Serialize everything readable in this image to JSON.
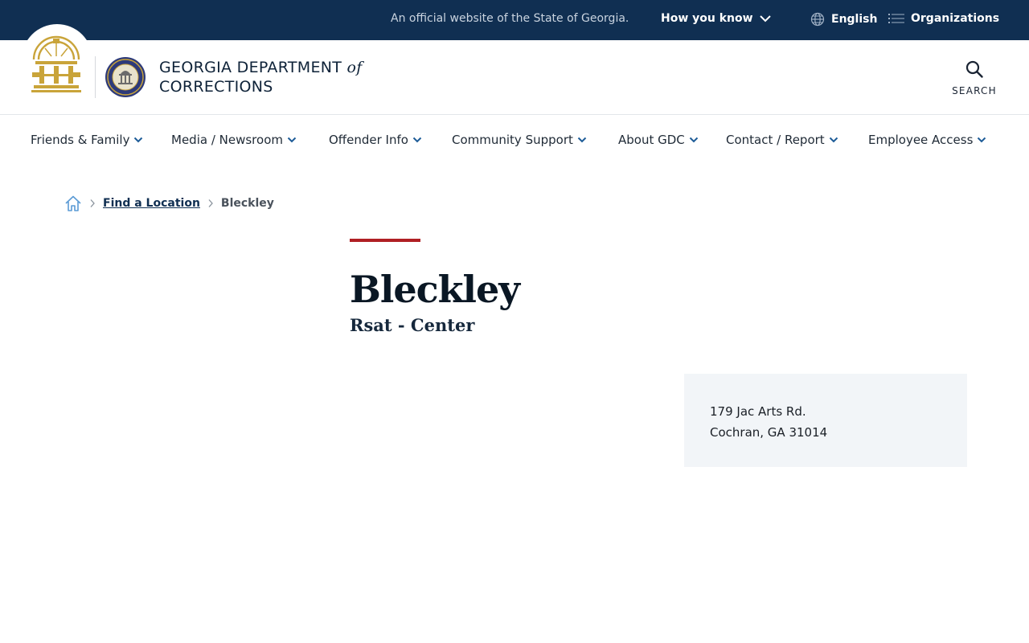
{
  "topbar": {
    "official_text": "An official website of the State of Georgia.",
    "how_you_know": "How you know",
    "language": "English",
    "organizations": "Organizations"
  },
  "header": {
    "agency_line1": "GEORGIA DEPARTMENT",
    "agency_of": "of",
    "agency_line2": "CORRECTIONS",
    "search_label": "SEARCH"
  },
  "nav": {
    "items": [
      {
        "label": "Friends & Family"
      },
      {
        "label": "Media / Newsroom"
      },
      {
        "label": "Offender Info"
      },
      {
        "label": "Community Support"
      },
      {
        "label": "About GDC"
      },
      {
        "label": "Contact / Report"
      },
      {
        "label": "Employee Access"
      }
    ]
  },
  "breadcrumb": {
    "home_icon": "home-icon",
    "link": "Find a Location",
    "current": "Bleckley"
  },
  "main": {
    "title": "Bleckley",
    "subtitle": "Rsat - Center"
  },
  "address": {
    "street": "179 Jac Arts Rd.",
    "city_state_zip": "Cochran, GA 31014"
  },
  "colors": {
    "topbar_bg": "#102f52",
    "accent_red": "#b01f24",
    "nav_chevron": "#1d5b97",
    "seal_gold": "#c9a43a",
    "card_bg": "#f2f5f8"
  }
}
